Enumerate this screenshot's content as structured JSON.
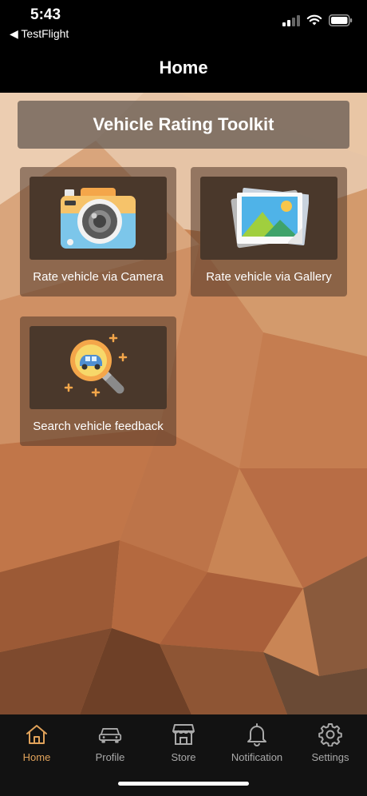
{
  "status_bar": {
    "time": "5:43",
    "back_app": "◀ TestFlight"
  },
  "nav": {
    "title": "Home"
  },
  "toolkit": {
    "title": "Vehicle Rating Toolkit"
  },
  "tiles": [
    {
      "label": "Rate vehicle via Camera",
      "icon": "camera-icon"
    },
    {
      "label": "Rate vehicle via Gallery",
      "icon": "gallery-icon"
    },
    {
      "label": "Search vehicle feedback",
      "icon": "search-car-icon"
    }
  ],
  "tab_bar": {
    "items": [
      {
        "label": "Home",
        "icon": "home-icon",
        "active": true
      },
      {
        "label": "Profile",
        "icon": "car-icon",
        "active": false
      },
      {
        "label": "Store",
        "icon": "store-icon",
        "active": false
      },
      {
        "label": "Notification",
        "icon": "bell-icon",
        "active": false
      },
      {
        "label": "Settings",
        "icon": "gear-icon",
        "active": false
      }
    ]
  },
  "colors": {
    "accent": "#e0a25a",
    "tab_inactive": "#a9a9a9",
    "tile_bg": "#4a382b"
  }
}
